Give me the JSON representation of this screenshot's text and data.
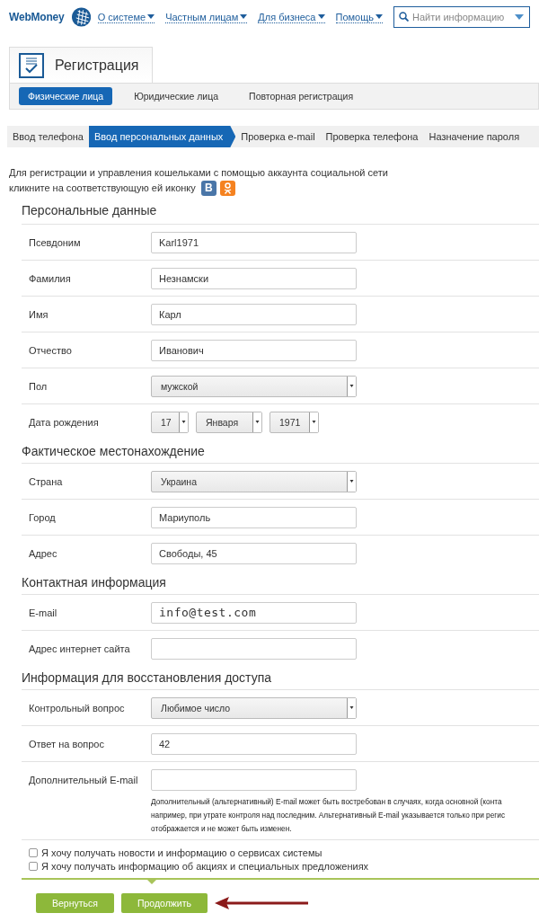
{
  "header": {
    "logo": "WebMoney",
    "nav": [
      {
        "label": "О системе"
      },
      {
        "label": "Частным лицам"
      },
      {
        "label": "Для бизнеса"
      },
      {
        "label": "Помощь"
      }
    ],
    "search": {
      "placeholder": "Найти информацию"
    }
  },
  "registration": {
    "title": "Регистрация",
    "subtabs": [
      {
        "label": "Физические лица",
        "selected": true
      },
      {
        "label": "Юридические лица",
        "selected": false
      },
      {
        "label": "Повторная регистрация",
        "selected": false
      }
    ]
  },
  "steps": [
    {
      "label": "Ввод телефона",
      "selected": false
    },
    {
      "label": "Ввод персональных данных",
      "selected": true
    },
    {
      "label": "Проверка e-mail",
      "selected": false
    },
    {
      "label": "Проверка телефона",
      "selected": false
    },
    {
      "label": "Назначение пароля",
      "selected": false
    }
  ],
  "intro": {
    "lines": [
      "Для регистрации и управления кошельками с помощью аккаунта социальной сети",
      "кликните на соответствующую ей иконку"
    ],
    "social": [
      {
        "kind": "vk",
        "label": "B"
      },
      {
        "kind": "ok"
      }
    ]
  },
  "sections": [
    {
      "title": "Персональные данные",
      "fields": [
        {
          "label": "Псевдоним",
          "kind": "text",
          "value": "Karl1971"
        },
        {
          "label": "Фамилия",
          "kind": "text",
          "value": "Незнамски"
        },
        {
          "label": "Имя",
          "kind": "text",
          "value": "Карл"
        },
        {
          "label": "Отчество",
          "kind": "text",
          "value": "Иванович"
        },
        {
          "label": "Пол",
          "kind": "select",
          "value": "мужской"
        },
        {
          "label": "Дата рождения",
          "kind": "date",
          "parts": [
            "17",
            "Января",
            "1971"
          ]
        }
      ]
    },
    {
      "title": "Фактическое местонахождение",
      "fields": [
        {
          "label": "Страна",
          "kind": "select",
          "value": "Украина"
        },
        {
          "label": "Город",
          "kind": "text",
          "value": "Мариуполь"
        },
        {
          "label": "Адрес",
          "kind": "text",
          "value": "Свободы, 45"
        }
      ]
    },
    {
      "title": "Контактная информация",
      "fields": [
        {
          "label": "E-mail",
          "kind": "email",
          "value": "info@test.com"
        },
        {
          "label": "Адрес интернет сайта",
          "kind": "text"
        }
      ]
    },
    {
      "title": "Информация для восстановления доступа",
      "fields": [
        {
          "label": "Контрольный вопрос",
          "kind": "select",
          "value": "Любимое число"
        },
        {
          "label": "Ответ на вопрос",
          "kind": "text",
          "value": "42"
        },
        {
          "label": "Дополнительный E-mail",
          "kind": "text",
          "help": [
            "Дополнительный (альтернативный) E-mail может быть востребован в случаях, когда основной (конта",
            "например, при утрате контроля над последним. Альтернативный E-mail указывается только при регис",
            "отображается и не может быть изменен."
          ]
        }
      ]
    }
  ],
  "checkboxes": [
    {
      "label": "Я хочу получать новости и информацию о сервисах системы",
      "checked": false
    },
    {
      "label": "Я хочу получать информацию об акциях и специальных предложениях",
      "checked": false
    }
  ],
  "buttons": [
    {
      "label": "Вернуться"
    },
    {
      "label": "Продолжить"
    }
  ]
}
